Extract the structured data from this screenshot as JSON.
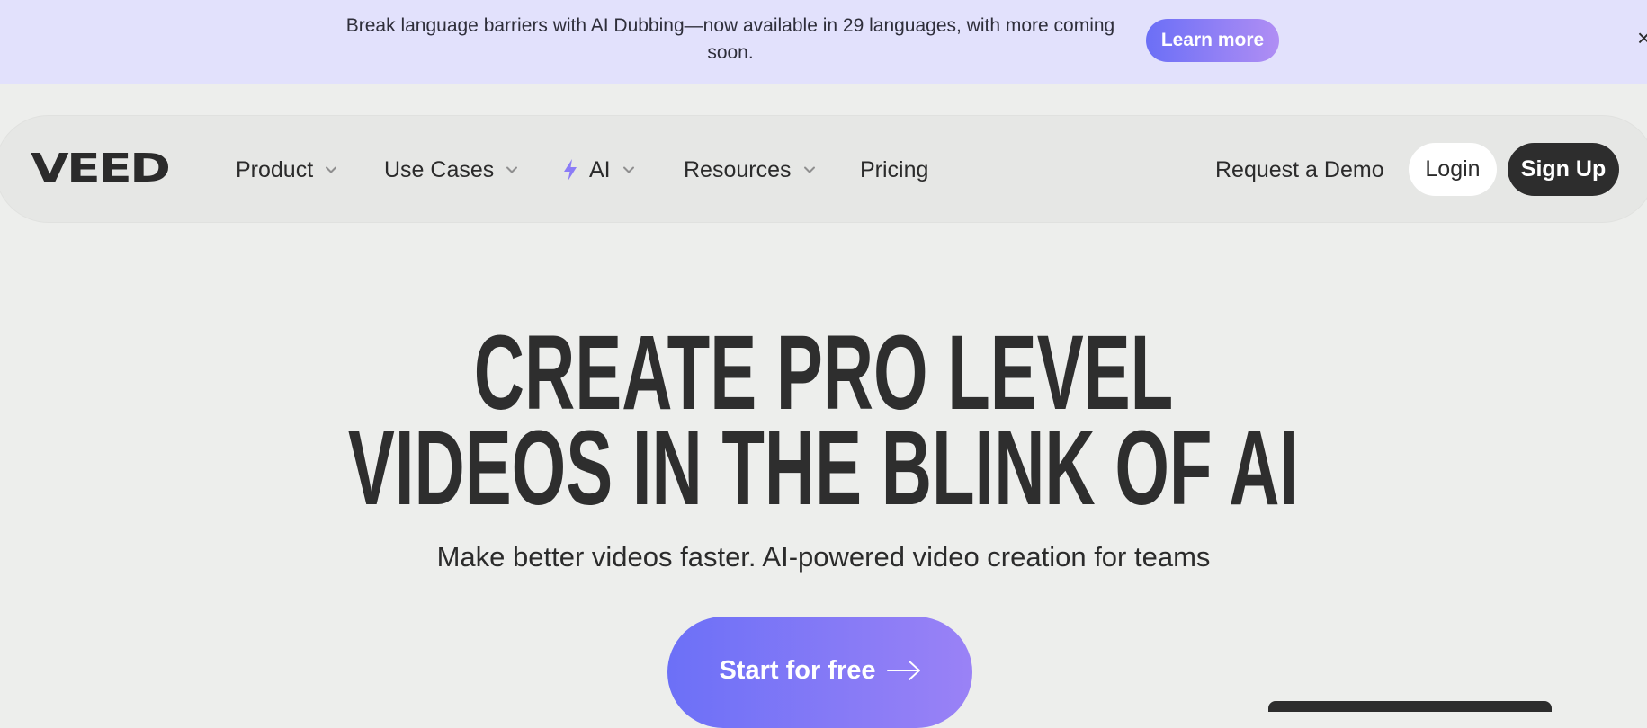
{
  "banner": {
    "text": "Break language barriers with AI Dubbing—now available in 29 languages, with more coming soon.",
    "button_label": "Learn more",
    "close_glyph": "×"
  },
  "nav": {
    "logo": "VEED",
    "items": [
      {
        "label": "Product",
        "has_dropdown": true,
        "icon": "chevron-down-icon"
      },
      {
        "label": "Use Cases",
        "has_dropdown": true,
        "icon": "chevron-down-icon"
      },
      {
        "label": "AI",
        "has_dropdown": true,
        "icon": "lightning-bolt-icon"
      },
      {
        "label": "Resources",
        "has_dropdown": true,
        "icon": "chevron-down-icon"
      },
      {
        "label": "Pricing",
        "has_dropdown": false
      }
    ],
    "request_demo": "Request a Demo",
    "login": "Login",
    "signup": "Sign Up"
  },
  "hero": {
    "title_line1": "CREATE PRO LEVEL",
    "title_line2": "VIDEOS IN THE BLINK OF AI",
    "subtitle": "Make better videos faster. AI-powered video creation for teams",
    "cta_label": "Start for free",
    "cta_icon": "arrow-right-icon"
  },
  "colors": {
    "page_bg": "#edeeec",
    "banner_bg": "#e2e1fc",
    "accent_start": "#6c70f7",
    "accent_end": "#9a82f6",
    "dark": "#2d2d2d",
    "bolt": "#8b7cf6"
  }
}
